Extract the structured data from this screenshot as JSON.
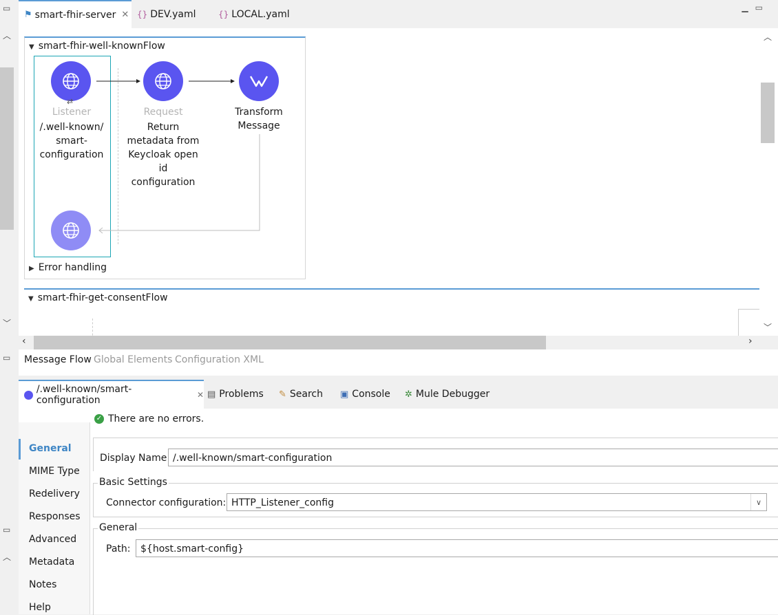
{
  "editor_tabs": [
    {
      "label": "smart-fhir-server",
      "closable": true
    },
    {
      "label": "DEV.yaml"
    },
    {
      "label": "LOCAL.yaml"
    }
  ],
  "flows": {
    "flow1": {
      "title": "smart-fhir-well-knownFlow",
      "listener": {
        "type": "Listener",
        "line1": "/.well-known/",
        "line2": "smart-",
        "line3": "configuration"
      },
      "request": {
        "type": "Request",
        "lines": [
          "Return",
          "metadata from",
          "Keycloak open",
          "id",
          "configuration"
        ]
      },
      "transform": {
        "line1": "Transform",
        "line2": "Message"
      },
      "error_handling": "Error handling"
    },
    "flow2": {
      "title": "smart-fhir-get-consentFlow"
    }
  },
  "canvas_tabs": {
    "message_flow": "Message Flow",
    "global_elements": "Global Elements",
    "configuration_xml": "Configuration XML"
  },
  "properties_tabs": {
    "component": "/.well-known/smart-configuration",
    "problems": "Problems",
    "search": "Search",
    "console": "Console",
    "debugger": "Mule Debugger"
  },
  "properties": {
    "status": "There are no errors.",
    "nav": [
      "General",
      "MIME Type",
      "Redelivery",
      "Responses",
      "Advanced",
      "Metadata",
      "Notes",
      "Help"
    ],
    "display_name_label": "Display Name:",
    "display_name_value": "/.well-known/smart-configuration",
    "basic_settings": "Basic Settings",
    "connector_label": "Connector configuration:",
    "connector_value": "HTTP_Listener_config",
    "general_group": "General",
    "path_label": "Path:",
    "path_value": "${host.smart-config}"
  },
  "colors": {
    "accent": "#5a9bd5",
    "node": "#5a55f0",
    "selection": "#1aa5b4",
    "success": "#3aa046"
  }
}
